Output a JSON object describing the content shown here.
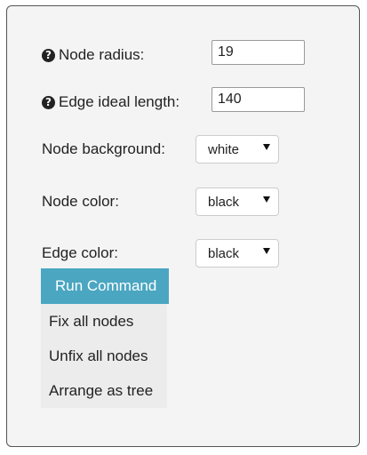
{
  "fields": {
    "node_radius": {
      "label": "Node radius:",
      "value": "19"
    },
    "edge_ideal_length": {
      "label": "Edge ideal length:",
      "value": "140"
    }
  },
  "selects": {
    "node_background": {
      "label": "Node background:",
      "value": "white"
    },
    "node_color": {
      "label": "Node color:",
      "value": "black"
    },
    "edge_color": {
      "label": "Edge color:",
      "value": "black"
    }
  },
  "command_menu": {
    "header": "Run Command",
    "items": [
      "Fix all nodes",
      "Unfix all nodes",
      "Arrange as tree"
    ]
  },
  "icons": {
    "help": "question-circle-icon",
    "dropdown": "caret-down-icon"
  },
  "colors": {
    "accent": "#4aa6c1",
    "panel_bg": "#f4f4f4",
    "menu_bg": "#ececec"
  }
}
